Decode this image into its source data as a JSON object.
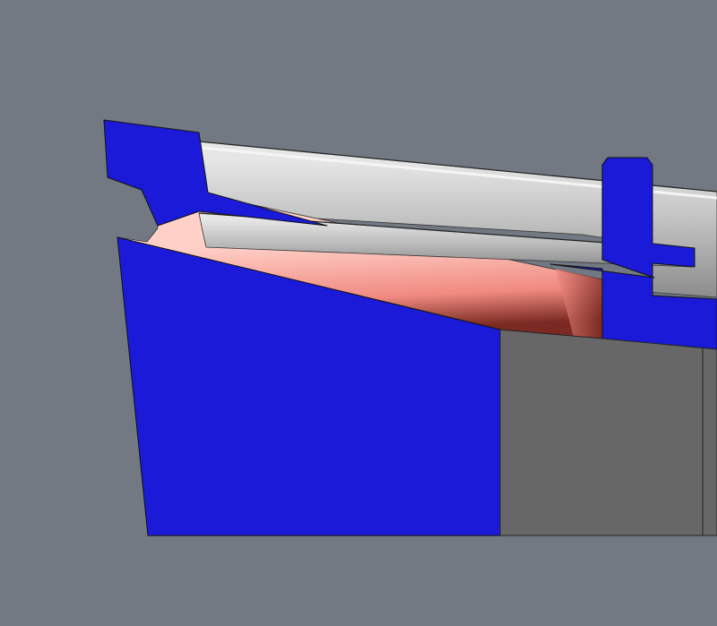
{
  "viewport": {
    "background_color": "#727983",
    "shading_mode": "cross-section"
  },
  "colors": {
    "section_fill": "#1a1ad8",
    "section_outline": "#111111",
    "bore_light": "#ffd0c8",
    "bore_mid": "#f08a80",
    "bore_dark": "#7a2a22",
    "rail_light": "#e6e6e6",
    "rail_mid": "#bdbdbd",
    "rail_dark": "#8c8c8c",
    "block_fill": "#676767",
    "block_outline": "#222222"
  },
  "parts": [
    {
      "name": "lower-body-section",
      "kind": "cut-face"
    },
    {
      "name": "top-flange-section",
      "kind": "cut-face"
    },
    {
      "name": "vertical-post-section",
      "kind": "cut-face"
    },
    {
      "name": "inner-bore-surface",
      "kind": "shaded-surface"
    },
    {
      "name": "top-rail-surface",
      "kind": "shaded-surface"
    },
    {
      "name": "inner-slot-surface",
      "kind": "shaded-surface"
    },
    {
      "name": "gray-block",
      "kind": "solid"
    }
  ]
}
